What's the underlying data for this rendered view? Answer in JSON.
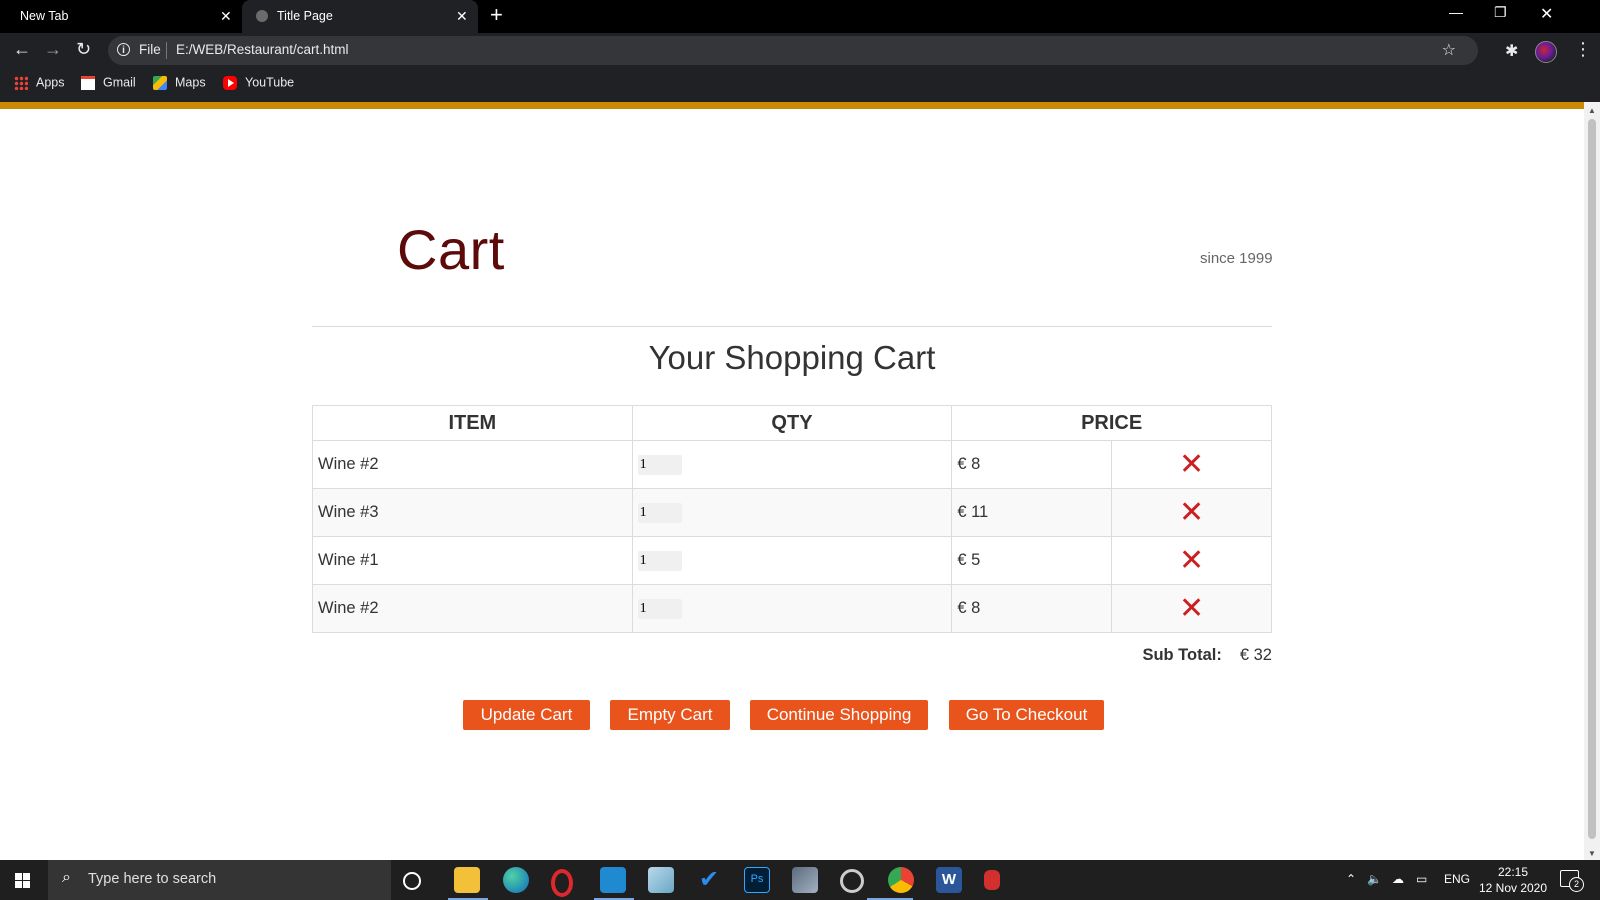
{
  "browser": {
    "tabs": [
      {
        "title": "New Tab",
        "active": false
      },
      {
        "title": "Title Page",
        "active": true
      }
    ],
    "address": {
      "scheme": "File",
      "url": "E:/WEB/Restaurant/cart.html"
    },
    "bookmarks": [
      {
        "label": "Apps",
        "icon": "apps-grid-icon"
      },
      {
        "label": "Gmail",
        "icon": "gmail-icon"
      },
      {
        "label": "Maps",
        "icon": "maps-icon"
      },
      {
        "label": "YouTube",
        "icon": "youtube-icon"
      }
    ],
    "accent_color": "#ca8a04"
  },
  "header": {
    "brand_title": "Cart",
    "tagline": "since 1999",
    "brand_color": "#5c0a0a"
  },
  "cart": {
    "heading": "Your Shopping Cart",
    "columns": [
      "ITEM",
      "QTY",
      "PRICE"
    ],
    "rows": [
      {
        "item": "Wine #2",
        "qty": "1",
        "price": "€ 8"
      },
      {
        "item": "Wine #3",
        "qty": "1",
        "price": "€ 11"
      },
      {
        "item": "Wine #1",
        "qty": "1",
        "price": "€ 5"
      },
      {
        "item": "Wine #2",
        "qty": "1",
        "price": "€ 8"
      }
    ],
    "remove_icon": "close-x-icon",
    "remove_color": "#cc1f1f",
    "subtotal_label": "Sub Total:",
    "subtotal_value": "€ 32",
    "buttons": {
      "update": "Update Cart",
      "empty": "Empty Cart",
      "continue": "Continue Shopping",
      "checkout": "Go To Checkout"
    },
    "button_color": "#e9541c"
  },
  "taskbar": {
    "search_placeholder": "Type here to search",
    "language": "ENG",
    "time": "22:15",
    "date": "12 Nov 2020",
    "notification_count": "2"
  }
}
